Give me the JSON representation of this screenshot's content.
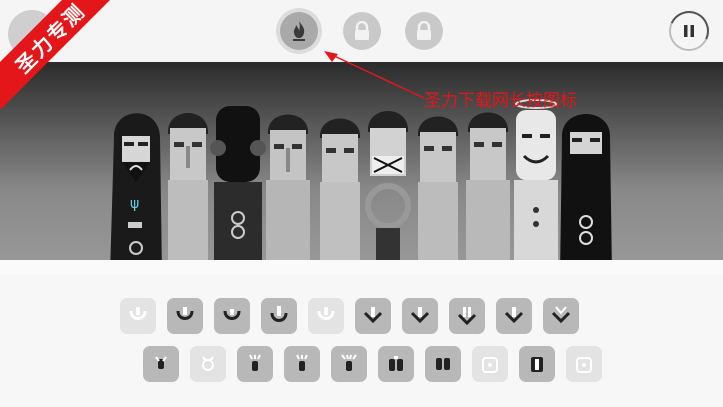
{
  "watermark": {
    "text": "圣力专测"
  },
  "annotation": {
    "text": "圣力下载网长按图标"
  },
  "topbar": {
    "buttons": [
      {
        "icon": "flame-icon",
        "state": "active"
      },
      {
        "icon": "lock-icon",
        "state": "locked"
      },
      {
        "icon": "lock-icon",
        "state": "locked"
      }
    ],
    "pause_icon": "pause-icon"
  },
  "stage": {
    "character_count": 10,
    "colors": {
      "background_top": "#2b2b2b",
      "background_bottom": "#9a9a9a",
      "accent_red": "#e4161a"
    }
  },
  "palette": {
    "row1": [
      {
        "icon": "beat-icon",
        "state": "used"
      },
      {
        "icon": "beat-icon",
        "state": "available"
      },
      {
        "icon": "beat-icon",
        "state": "available"
      },
      {
        "icon": "beat-icon",
        "state": "available"
      },
      {
        "icon": "beat-icon",
        "state": "used"
      },
      {
        "icon": "effect-arrow-icon",
        "state": "available"
      },
      {
        "icon": "effect-arrow-icon",
        "state": "available"
      },
      {
        "icon": "effect-arrow-icon",
        "state": "available"
      },
      {
        "icon": "effect-arrow-icon",
        "state": "available"
      },
      {
        "icon": "effect-arrow-icon",
        "state": "available"
      }
    ],
    "row2": [
      {
        "icon": "melody-icon",
        "state": "available"
      },
      {
        "icon": "melody-icon",
        "state": "used"
      },
      {
        "icon": "melody-icon",
        "state": "available"
      },
      {
        "icon": "melody-icon",
        "state": "available"
      },
      {
        "icon": "melody-icon",
        "state": "available"
      },
      {
        "icon": "voice-icon",
        "state": "available"
      },
      {
        "icon": "voice-icon",
        "state": "available"
      },
      {
        "icon": "voice-icon",
        "state": "used"
      },
      {
        "icon": "voice-icon",
        "state": "available"
      },
      {
        "icon": "voice-icon",
        "state": "used"
      }
    ]
  }
}
